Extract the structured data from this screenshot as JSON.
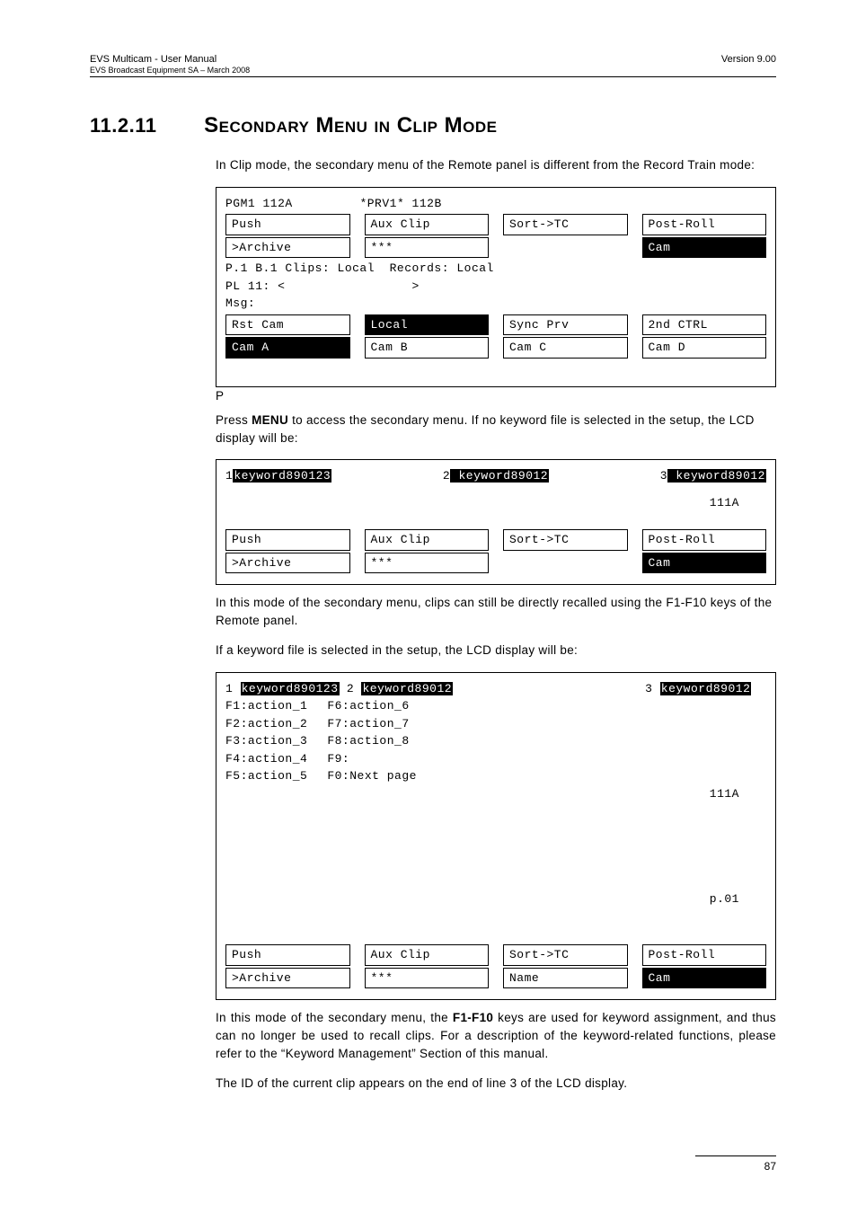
{
  "header": {
    "left_line1": "EVS Multicam - User Manual",
    "left_line2": "EVS Broadcast Equipment SA – March 2008",
    "right": "Version 9.00"
  },
  "section": {
    "number": "11.2.11",
    "title": "Secondary Menu in Clip Mode"
  },
  "para": {
    "intro": "In Clip mode, the secondary menu of the Remote panel is different from the Record Train mode:",
    "stray_p": "P",
    "press_menu_1a": "Press ",
    "press_menu_bold": "MENU",
    "press_menu_1b": " to access the secondary menu. If no keyword file is selected in the setup, the LCD display will be:",
    "recall_para": "In this mode of the secondary menu, clips can still be directly recalled using the F1-F10 keys of the Remote panel.",
    "if_kw": "If a keyword file is selected in the setup, the LCD display will be:",
    "last_1a": "In this mode of the secondary menu, the ",
    "last_bold": "F1-F10",
    "last_1b": " keys are used for keyword assignment, and thus can no longer be used to recall clips. For a description of the keyword-related functions, please refer to the “Keyword Management” Section of this manual.",
    "id_line": "The ID of the current clip appears on the end of line 3 of the LCD display."
  },
  "lcd1": {
    "hdr_left": "PGM1 112A",
    "hdr_right": "*PRV1* 112B",
    "r1": {
      "c1": "Push",
      "c2": "Aux Clip",
      "c3": "Sort->TC",
      "c4": "Post-Roll"
    },
    "r2": {
      "c1": ">Archive",
      "c2": "***",
      "c4": "Cam"
    },
    "line_clips": "P.1 B.1 Clips: Local  Records: Local",
    "line_pl": "PL 11: <                 >",
    "line_msg": "Msg:",
    "r3": {
      "c1": "Rst Cam",
      "c2": "Local",
      "c3": "Sync Prv",
      "c4": "2nd CTRL"
    },
    "r4": {
      "c1": "Cam A",
      "c2": "Cam B",
      "c3": "Cam C",
      "c4": "Cam D"
    }
  },
  "lcd2": {
    "k1_pre": "1",
    "k1": "keyword890123",
    "k2_pre": "2",
    "k2": " keyword89012",
    "k3_pre": "3",
    "k3": " keyword89012",
    "code": "111A",
    "r1": {
      "c1": "Push",
      "c2": "Aux Clip",
      "c3": "Sort->TC",
      "c4": "Post-Roll"
    },
    "r2": {
      "c1": ">Archive",
      "c2": "***",
      "c4": "Cam"
    }
  },
  "lcd3": {
    "k1_pre": "1 ",
    "k1": "keyword890123",
    "k2_pre": " 2 ",
    "k2": "keyword89012",
    "k3_pre": "3 ",
    "k3": "keyword89012",
    "fcol1": "F1:action_1\nF2:action_2\nF3:action_3\nF4:action_4\nF5:action_5",
    "fcol2": "F6:action_6\nF7:action_7\nF8:action_8\nF9:\nF0:Next page",
    "right1": "111A",
    "right2": "p.01",
    "r1": {
      "c1": "Push",
      "c2": "Aux Clip",
      "c3": "Sort->TC",
      "c4": "Post-Roll"
    },
    "r2": {
      "c1": ">Archive",
      "c2": "***",
      "c3": "Name",
      "c4": "Cam"
    }
  },
  "footer": {
    "page": "87"
  }
}
